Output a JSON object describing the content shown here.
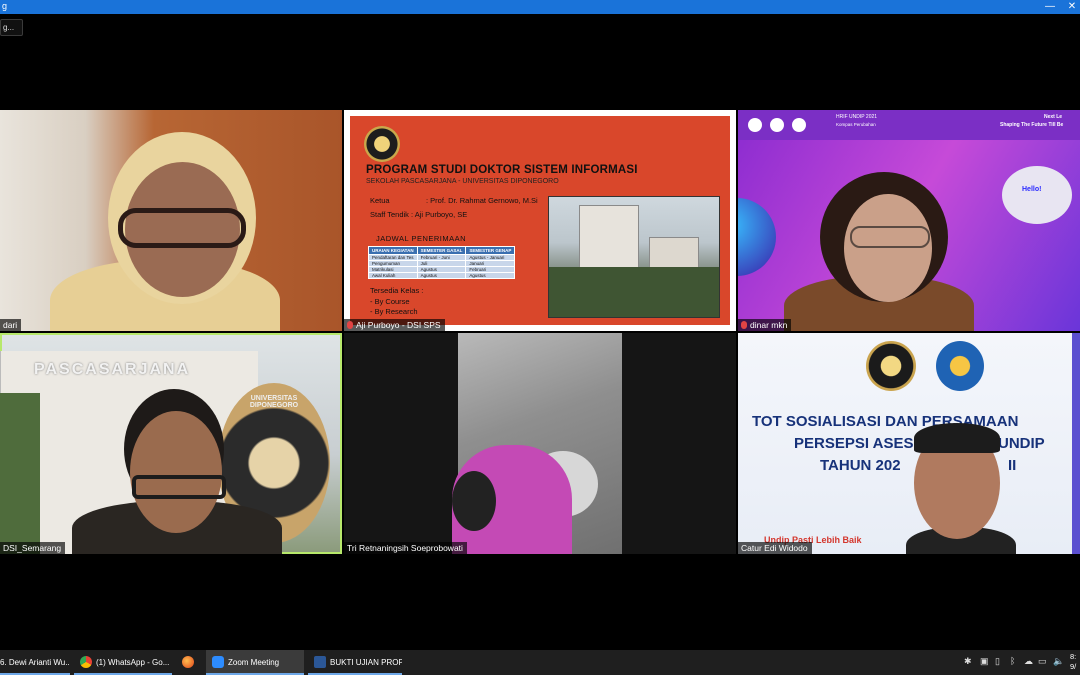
{
  "window": {
    "title": "g",
    "minimize": "—",
    "close": "✕"
  },
  "view_pill": {
    "label": "g..."
  },
  "tiles": [
    {
      "name": "dari"
    },
    {
      "name": "Aji Purboyo - DSI SPS"
    },
    {
      "name": "dinar mkn"
    },
    {
      "name": "DSI_Semarang"
    },
    {
      "name": "Tri Retnaningsih Soeprobowati"
    },
    {
      "name": "Catur Edi Widodo"
    }
  ],
  "slide": {
    "title": "PROGRAM STUDI DOKTOR SISTEM INFORMASI",
    "subtitle": "SEKOLAH PASCASARJANA - UNIVERSITAS DIPONEGORO",
    "ketua_label": "Ketua",
    "ketua_value": ": Prof. Dr. Rahmat Gernowo, M.Si",
    "staff": "Staff Tendik : Aji Purboyo, SE",
    "schedule_heading": "JADWAL PENERIMAAN",
    "table_headers": [
      "URAIAN KEGIATAN",
      "SEMESTER GASAL",
      "SEMESTER GENAP"
    ],
    "table_rows": [
      [
        "Pendaftaran dan Tes",
        "Februari - Juni",
        "Agustus - Januari"
      ],
      [
        "Pengumuman",
        "Juli",
        "Januari"
      ],
      [
        "Matrikulasi",
        "Agustus",
        "Februari"
      ],
      [
        "Awal Kuliah",
        "Agustus",
        "Agustus"
      ]
    ],
    "classes_heading": "Tersedia Kelas :",
    "classes": [
      "- By Course",
      "- By Research"
    ]
  },
  "tile3_bg": {
    "line1": "HRIF UNDIP 2021",
    "line2": "Kompas Perubahan",
    "right1": "Next Le",
    "right2": "Shaping The Future Till Be",
    "robot": "Hello!"
  },
  "tile4_bg": {
    "building": "PASCASARJANA",
    "seal": "UNIVERSITAS DIPONEGORO"
  },
  "tile6_bg": {
    "line1": "TOT SOSIALISASI DAN PERSAMAAN",
    "line2": "PERSEPSI ASES",
    "line2b": "UNDIP",
    "line3": "TAHUN 202",
    "line3b": "II",
    "footer": "Undip Pasti Lebih Baik"
  },
  "taskbar": {
    "items": [
      {
        "label": "6. Dewi Arianti Wu...",
        "icon": "document-icon"
      },
      {
        "label": "(1) WhatsApp - Go...",
        "icon": "chrome-icon"
      },
      {
        "label": "",
        "icon": "firefox-icon"
      },
      {
        "label": "Zoom Meeting",
        "icon": "zoom-icon"
      },
      {
        "label": "BUKTI UJIAN PROP...",
        "icon": "word-icon"
      }
    ],
    "clock_time": "8:",
    "clock_date": "9/"
  },
  "colors": {
    "titlebar": "#1a73d9",
    "active_speaker": "#b7e86b",
    "slide_bg": "#d9472b",
    "taskbar": "#1f1f1f"
  }
}
